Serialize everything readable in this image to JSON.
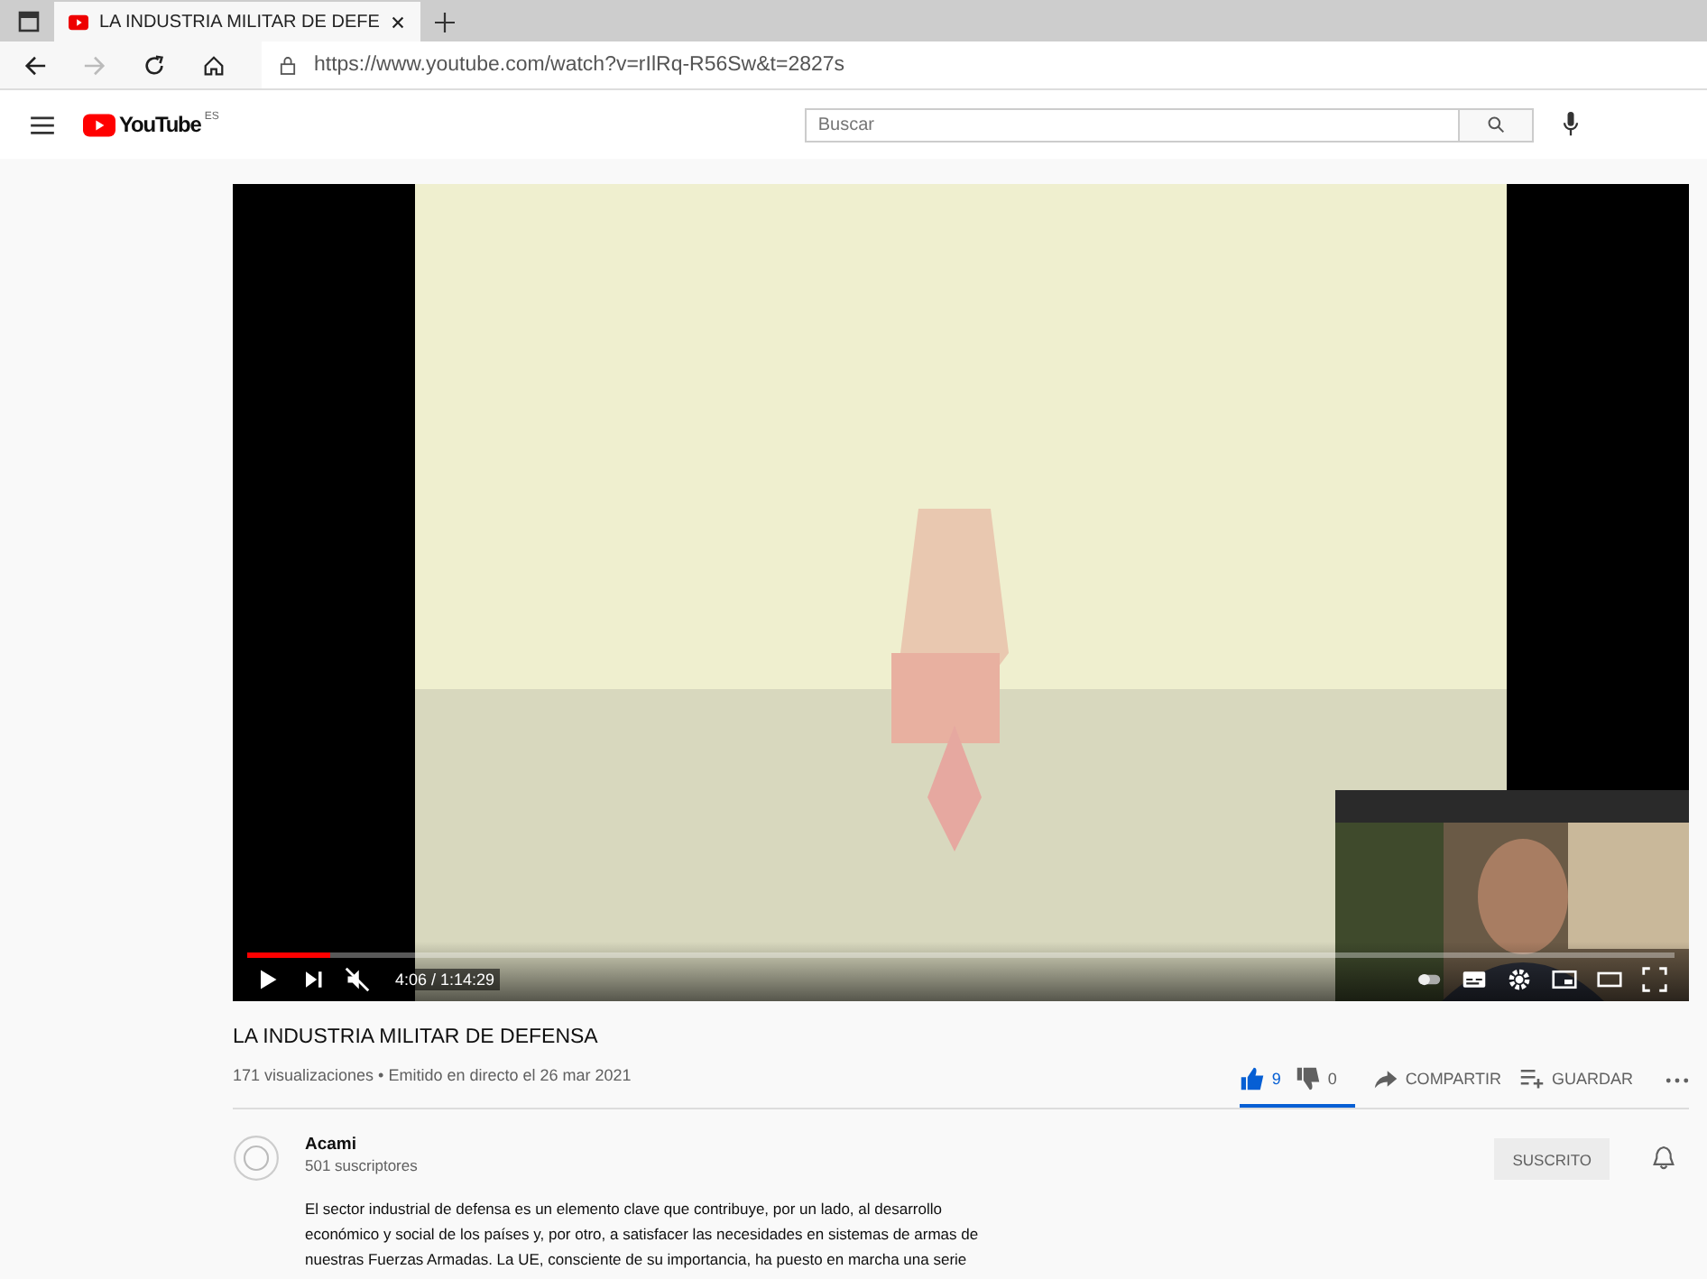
{
  "browser": {
    "tab_title": "LA INDUSTRIA MILITAR DE DEFE",
    "url": "https://www.youtube.com/watch?v=rIlRq-R56Sw&t=2827s"
  },
  "header": {
    "logo_text": "YouTube",
    "region": "ES",
    "search": {
      "placeholder": "Buscar"
    }
  },
  "video": {
    "kind": "picture",
    "progress": {
      "level": 0.058
    },
    "time": "4:06 / 1:14:29",
    "muted": true
  },
  "title": "LA INDUSTRIA MILITAR DE DEFENSA",
  "meta": "171 visualizaciones • Emitido en directo el 26 mar 2021",
  "actions": {
    "likes": "9",
    "liked": true,
    "dislikes": "0",
    "sentiment": {
      "level": 1
    },
    "share": "COMPARTIR",
    "save": "GUARDAR"
  },
  "channel": {
    "name": "Acami",
    "subscribers": "501 suscriptores",
    "subscribe": "SUSCRITO"
  },
  "description": "El sector industrial de defensa es un elemento clave que contribuye, por un lado, al desarrollo económico y social de los países y, por otro, a satisfacer las necesidades en sistemas de armas de nuestras Fuerzas Armadas. La UE, consciente de su importancia, ha puesto en marcha una serie"
}
